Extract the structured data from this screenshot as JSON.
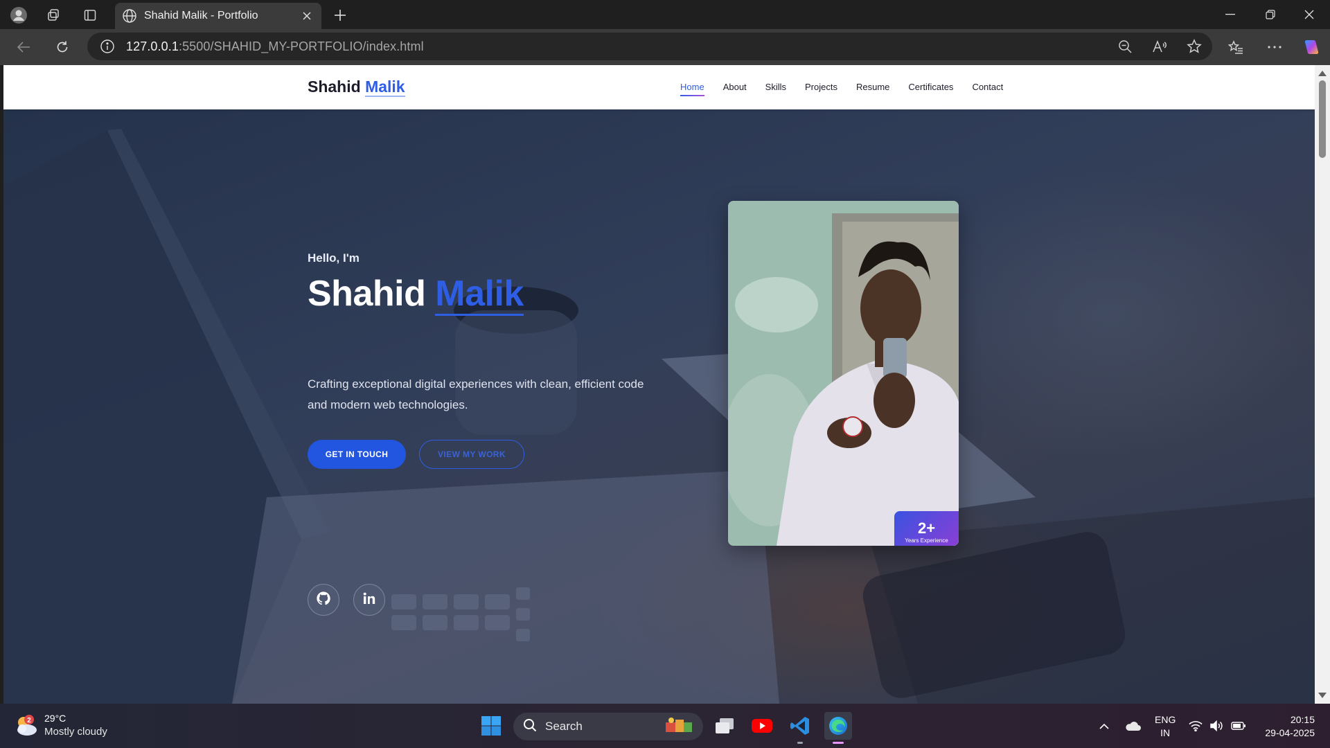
{
  "browser": {
    "tab_title": "Shahid Malik - Portfolio",
    "url_host": "127.0.0.1",
    "url_rest": ":5500/SHAHID_MY-PORTFOLIO/index.html"
  },
  "site": {
    "logo_first": "Shahid",
    "logo_accent": "Malik",
    "nav": [
      "Home",
      "About",
      "Skills",
      "Projects",
      "Resume",
      "Certificates",
      "Contact"
    ],
    "active_nav": "Home"
  },
  "hero": {
    "greeting": "Hello, I'm",
    "name_first": "Shahid",
    "name_accent": "Malik",
    "description": "Crafting exceptional digital experiences with clean, efficient code and modern web technologies.",
    "primary_button": "GET IN TOUCH",
    "secondary_button": "VIEW MY WORK",
    "experience_number": "2+",
    "experience_label": "Years Experience",
    "social": [
      "github-icon",
      "linkedin-icon"
    ]
  },
  "taskbar": {
    "weather_temp": "29°C",
    "weather_condition": "Mostly cloudy",
    "weather_badge": "2",
    "search_label": "Search",
    "lang_1": "ENG",
    "lang_2": "IN",
    "time": "20:15",
    "date": "29-04-2025"
  },
  "colors": {
    "accent": "#2f5ee6",
    "hero_overlay": "#2c3a55",
    "badge_gradient_start": "#3b52e0",
    "badge_gradient_end": "#8a3fd6"
  }
}
